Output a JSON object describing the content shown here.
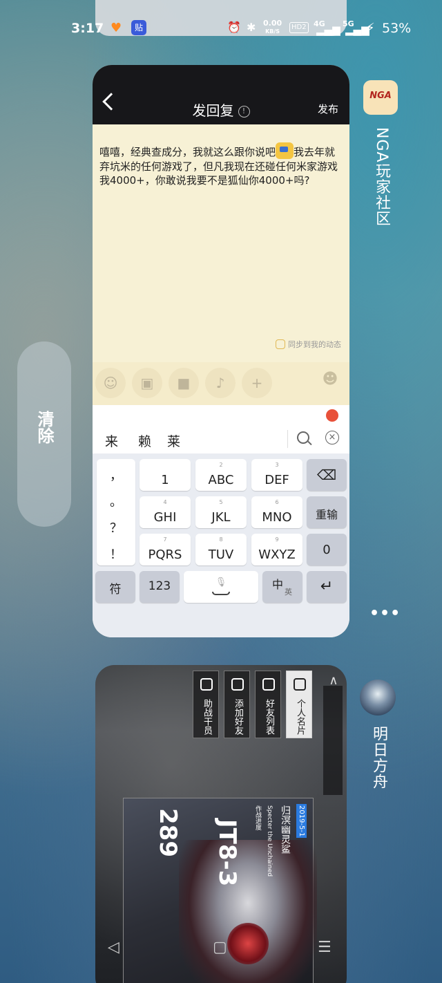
{
  "status_bar": {
    "time": "3:17",
    "net_speed_value": "0.00",
    "net_speed_unit": "KB/S",
    "hd_label": "HD2",
    "sig1_label": "4G",
    "sig2_label": "5G",
    "battery": "53%"
  },
  "recents": {
    "clear_label": "清除",
    "more_label": "•••"
  },
  "nga_card": {
    "app_name": "NGA玩家社区",
    "app_icon_text": "NGA",
    "header_title": "发回复",
    "info_glyph": "!",
    "publish_label": "发布",
    "reply_text_1": "嘻嘻，经典查成分，我就这么跟你说吧",
    "reply_text_2": "我去年就弃坑米的任何游戏了，但凡我现在还碰任何米家游戏我4000+，你敢说我要不是狐仙你4000+吗?",
    "sync_label": "同步到我的动态",
    "toolbar": {
      "emoji": "☺",
      "image": "▣",
      "video": "■",
      "mic": "♪",
      "plus": "+",
      "mask": "☻"
    }
  },
  "keyboard": {
    "candidates": [
      "来",
      "赖",
      "莱"
    ],
    "punct": [
      "，",
      "。",
      "？",
      "！"
    ],
    "rows": [
      [
        {
          "num": "",
          "label": "1"
        },
        {
          "num": "2",
          "label": "ABC"
        },
        {
          "num": "3",
          "label": "DEF"
        }
      ],
      [
        {
          "num": "4",
          "label": "GHI"
        },
        {
          "num": "5",
          "label": "JKL"
        },
        {
          "num": "6",
          "label": "MNO"
        }
      ],
      [
        {
          "num": "7",
          "label": "PQRS"
        },
        {
          "num": "8",
          "label": "TUV"
        },
        {
          "num": "9",
          "label": "WXYZ"
        }
      ]
    ],
    "backspace": "⌫",
    "reinput": "重输",
    "zero": "0",
    "symbol": "符",
    "num_switch": "123",
    "space_mic": "🎙",
    "lang_main": "中",
    "lang_sub": "英",
    "enter": "↵"
  },
  "ark_card": {
    "app_name": "明日方舟",
    "buttons": [
      "个人名片",
      "好友列表",
      "添加好友",
      "助战干员"
    ],
    "stage": "JT8-3",
    "stage_sub": "作战进度",
    "char_name": "归溟幽灵鲨",
    "char_sub": "Specter the Unchained",
    "date": "2019-5-1",
    "level": "289",
    "nav": [
      "◁",
      "▢",
      "☰"
    ]
  }
}
